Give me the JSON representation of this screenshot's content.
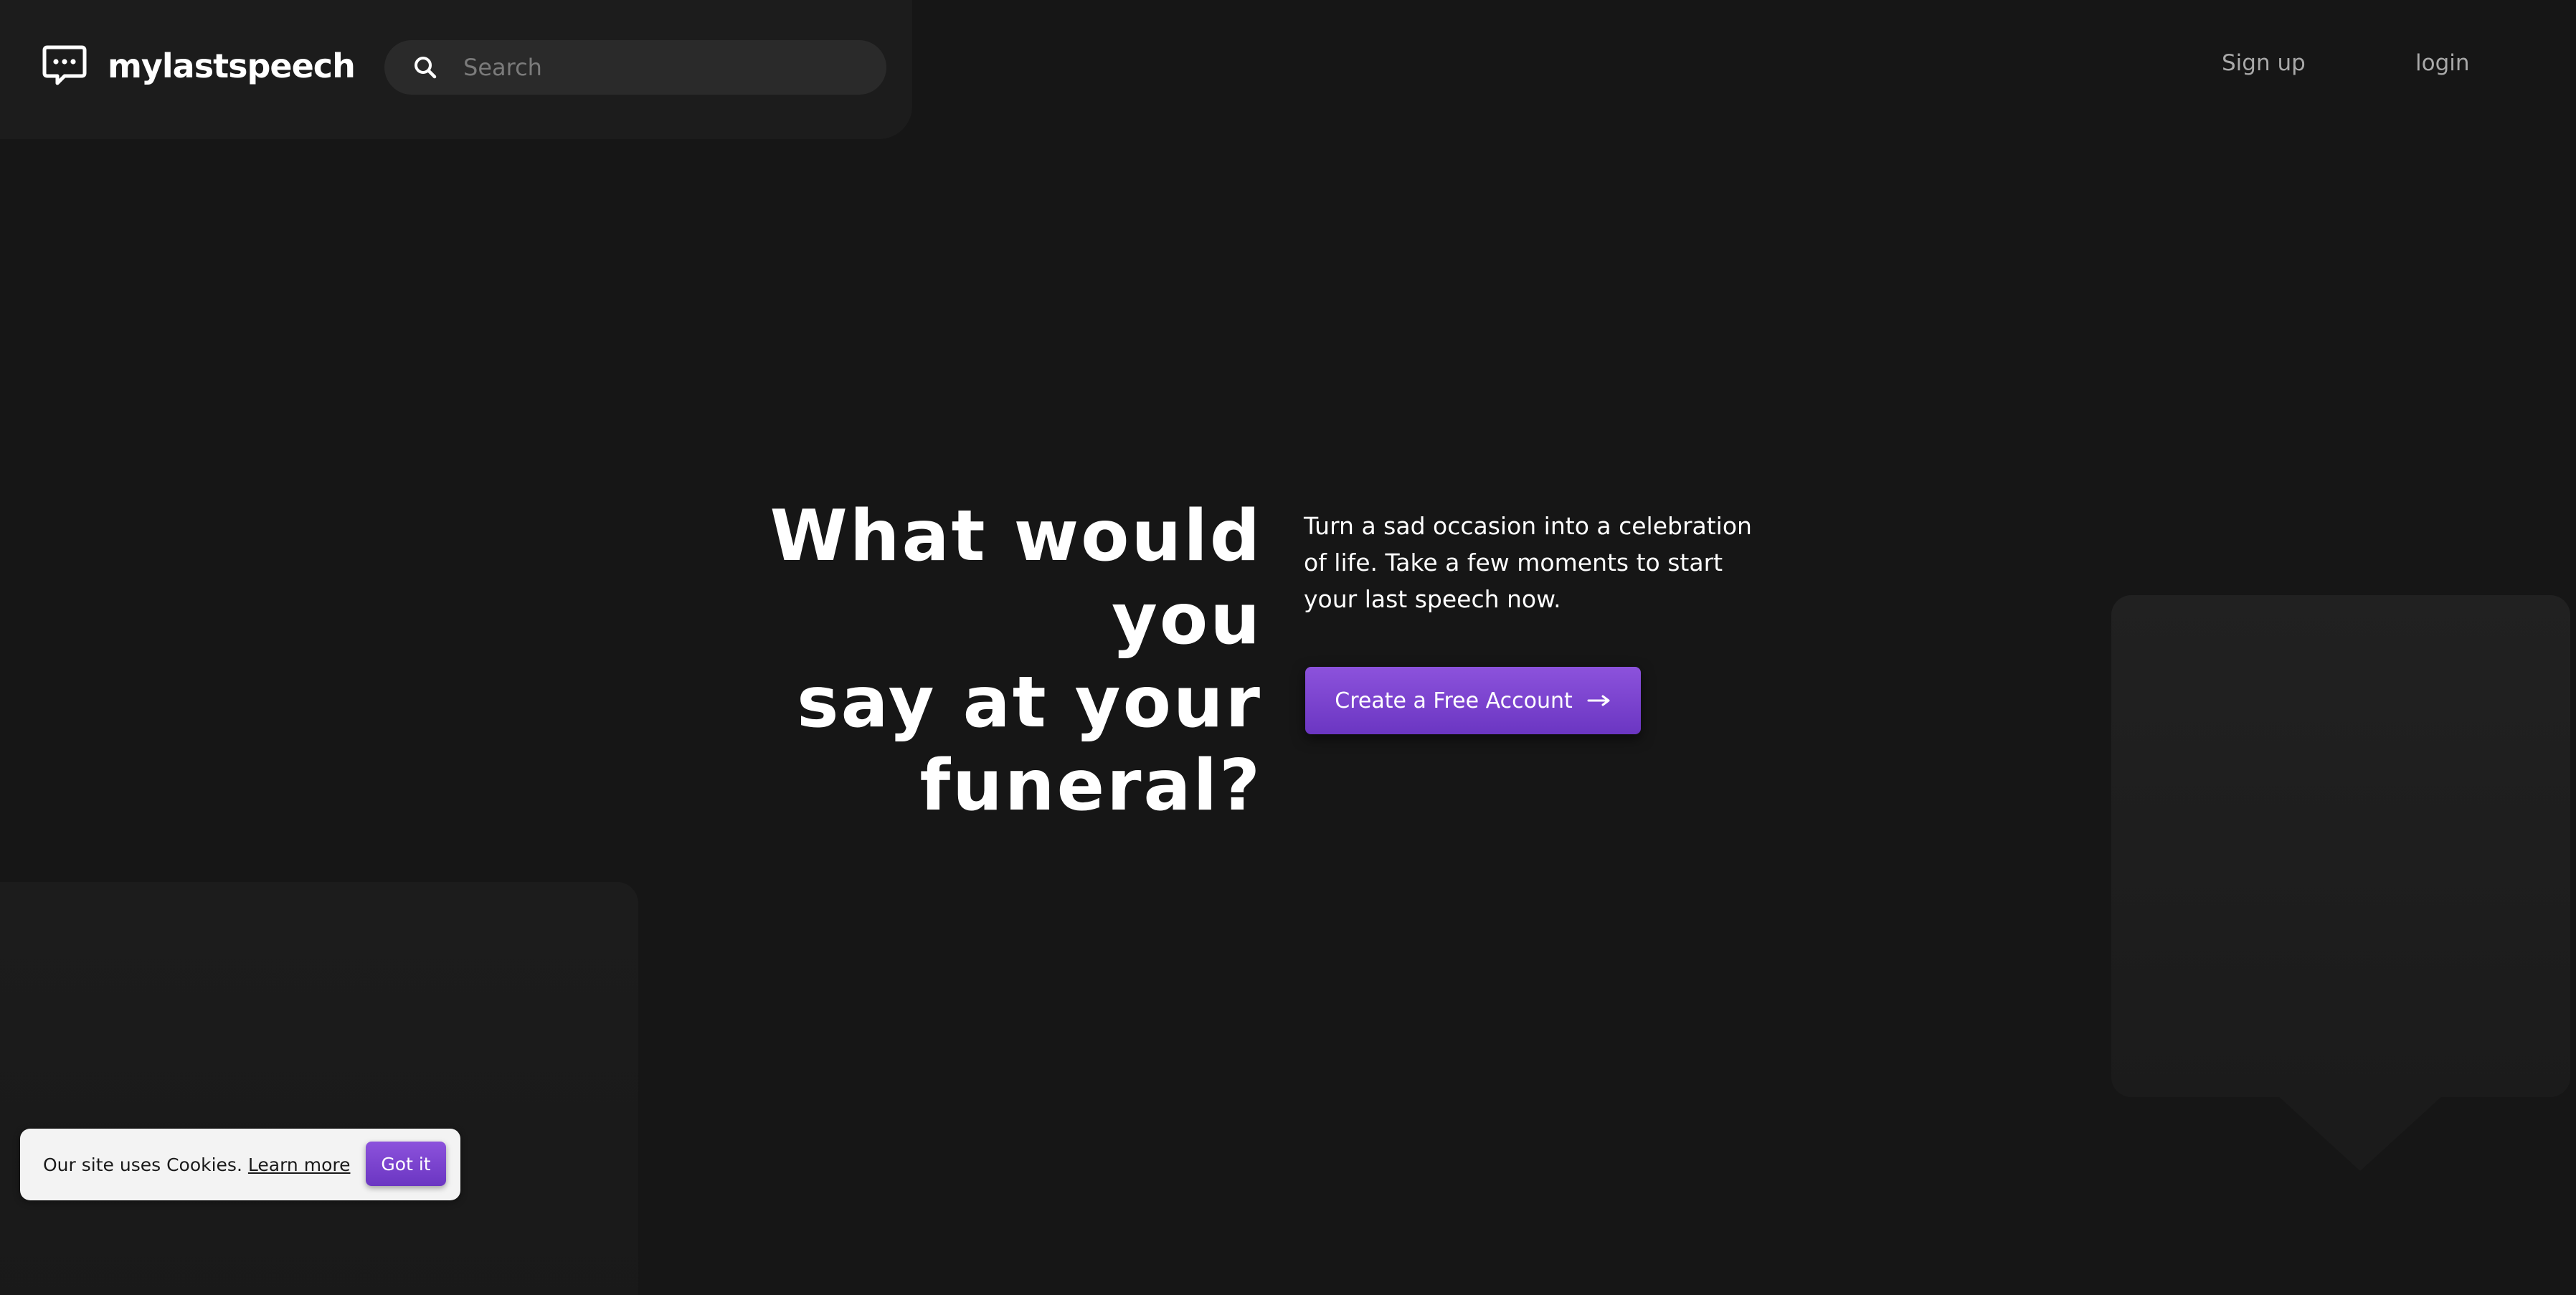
{
  "header": {
    "brand": "mylastspeech",
    "logo_icon": "speech-bubble-ellipsis-icon",
    "search": {
      "placeholder": "Search",
      "value": "",
      "icon": "search-icon"
    },
    "nav": {
      "signup_label": "Sign up",
      "login_label": "login"
    }
  },
  "hero": {
    "heading_lines": [
      "What would you",
      "say at your",
      "funeral?"
    ],
    "description": "Turn a sad occasion into a celebration of life. Take a few moments to start your last speech now.",
    "cta_label": "Create a Free Account",
    "cta_icon": "arrow-right-icon"
  },
  "cookie_banner": {
    "text": "Our site uses Cookies.",
    "link_label": "Learn more",
    "button_label": "Got it"
  },
  "colors": {
    "background": "#161616",
    "header_panel": "#1c1c1c",
    "search_field": "#2a2a2a",
    "accent": "#7c46d4",
    "nav_text": "#a9a9a9",
    "cookie_background": "#f3f3f3"
  }
}
